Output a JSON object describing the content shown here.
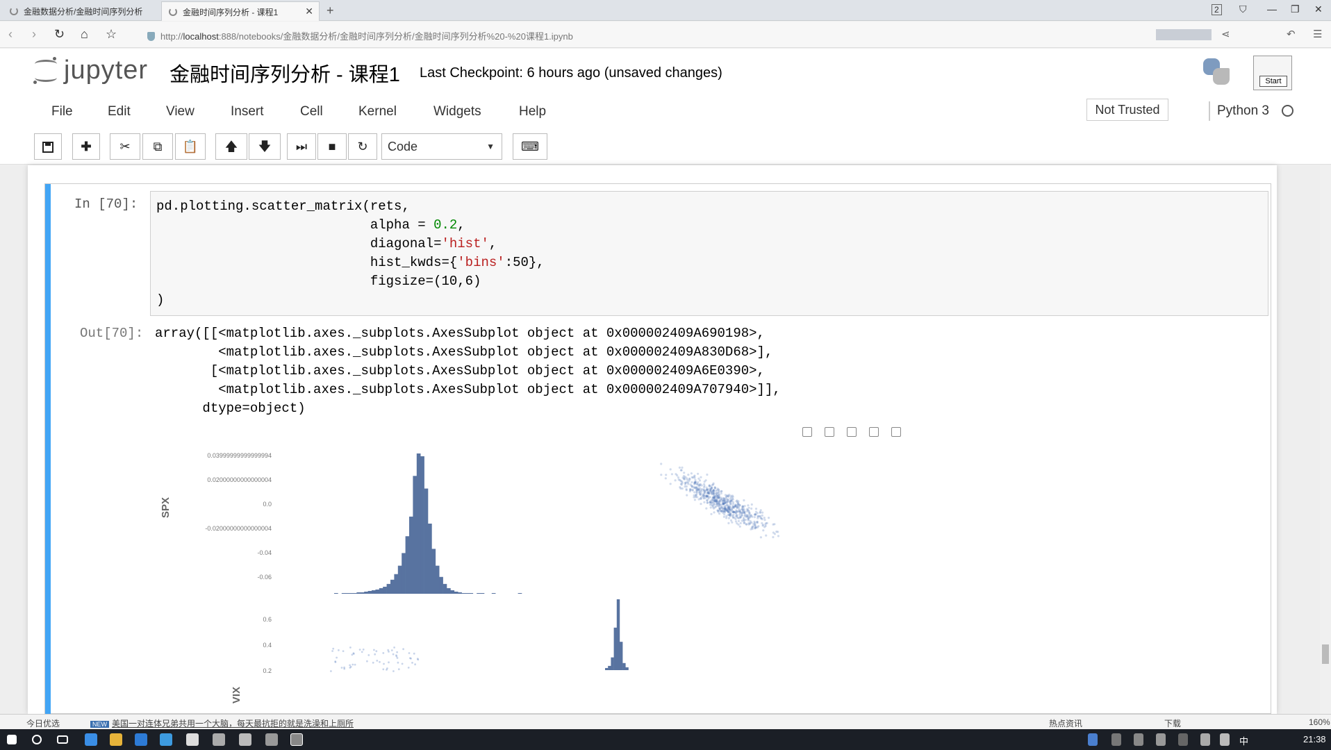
{
  "browser": {
    "tabs": [
      {
        "label": "金融数据分析/金融时间序列分析",
        "active": false
      },
      {
        "label": "金融时间序列分析 - 课程1",
        "active": true
      }
    ],
    "url_prefix": "http://",
    "url_host": "localhost",
    "url_rest": ":888/notebooks/金融数据分析/金融时间序列分析/金融时间序列分析%20-%20课程1.ipynb",
    "tab_count_badge": "2"
  },
  "jupyter": {
    "brand": "jupyter",
    "notebook_title": "金融时间序列分析 - 课程1",
    "checkpoint": "Last Checkpoint: 6 hours ago (unsaved changes)",
    "start_label": "Start",
    "menu": [
      "File",
      "Edit",
      "View",
      "Insert",
      "Cell",
      "Kernel",
      "Widgets",
      "Help"
    ],
    "trusted_label": "Not Trusted",
    "kernel_name": "Python 3",
    "cell_type": "Code"
  },
  "cell": {
    "in_prompt": "In  [70]:",
    "out_prompt": "Out[70]:",
    "code_lines": [
      {
        "pre": "pd.plotting.scatter_matrix(rets,",
        "str": "",
        "post": ""
      },
      {
        "pre": "                           alpha = ",
        "str": "",
        "num": "0.2",
        "post": ","
      },
      {
        "pre": "                           diagonal=",
        "str": "'hist'",
        "post": ","
      },
      {
        "pre": "                           hist_kwds={",
        "str": "'bins'",
        "post": ":50},"
      },
      {
        "pre": "                           figsize=(10,6)",
        "str": "",
        "post": ""
      },
      {
        "pre": ")",
        "str": "",
        "post": ""
      }
    ],
    "output_lines": [
      "array([[<matplotlib.axes._subplots.AxesSubplot object at 0x000002409A690198>,",
      "        <matplotlib.axes._subplots.AxesSubplot object at 0x000002409A830D68>],",
      "       [<matplotlib.axes._subplots.AxesSubplot object at 0x000002409A6E0390>,",
      "        <matplotlib.axes._subplots.AxesSubplot object at 0x000002409A707940>]],",
      "      dtype=object)"
    ]
  },
  "chart_data": {
    "type": "scatter",
    "description_type": "scatter_matrix",
    "ylabel_top": "SPX",
    "ylabel_bottom": "VIX",
    "top_row_ticks": [
      "0.03999999999999994",
      "0.02000000000000004",
      "0.0",
      "-0.02000000000000004",
      "-0.04",
      "-0.06"
    ],
    "bottom_row_ticks": [
      "0.6",
      "0.4",
      "0.2"
    ],
    "spx_hist_heights": [
      1,
      0,
      1,
      1,
      1,
      1,
      2,
      2,
      3,
      4,
      5,
      6,
      8,
      10,
      14,
      20,
      28,
      40,
      58,
      82,
      110,
      168,
      200,
      196,
      150,
      100,
      64,
      40,
      24,
      14,
      8,
      5,
      3,
      2,
      1,
      1,
      1,
      0,
      1,
      1,
      0,
      0,
      1,
      0,
      0,
      0,
      0,
      0,
      0,
      1
    ],
    "vix_hist_heights": [
      3,
      6,
      18,
      60,
      100,
      40,
      10,
      4
    ],
    "scatter_spread": "negative correlation"
  },
  "statusbar": {
    "left_label": "今日优选",
    "news_badge": "NEW",
    "news": "美国一对连体兄弟共用一个大脑，每天最抗拒的就是洗澡和上厕所",
    "right_news": "热点资讯",
    "download": "下载",
    "zoom": "160%"
  },
  "taskbar": {
    "time": "21:38",
    "lang": "中"
  }
}
